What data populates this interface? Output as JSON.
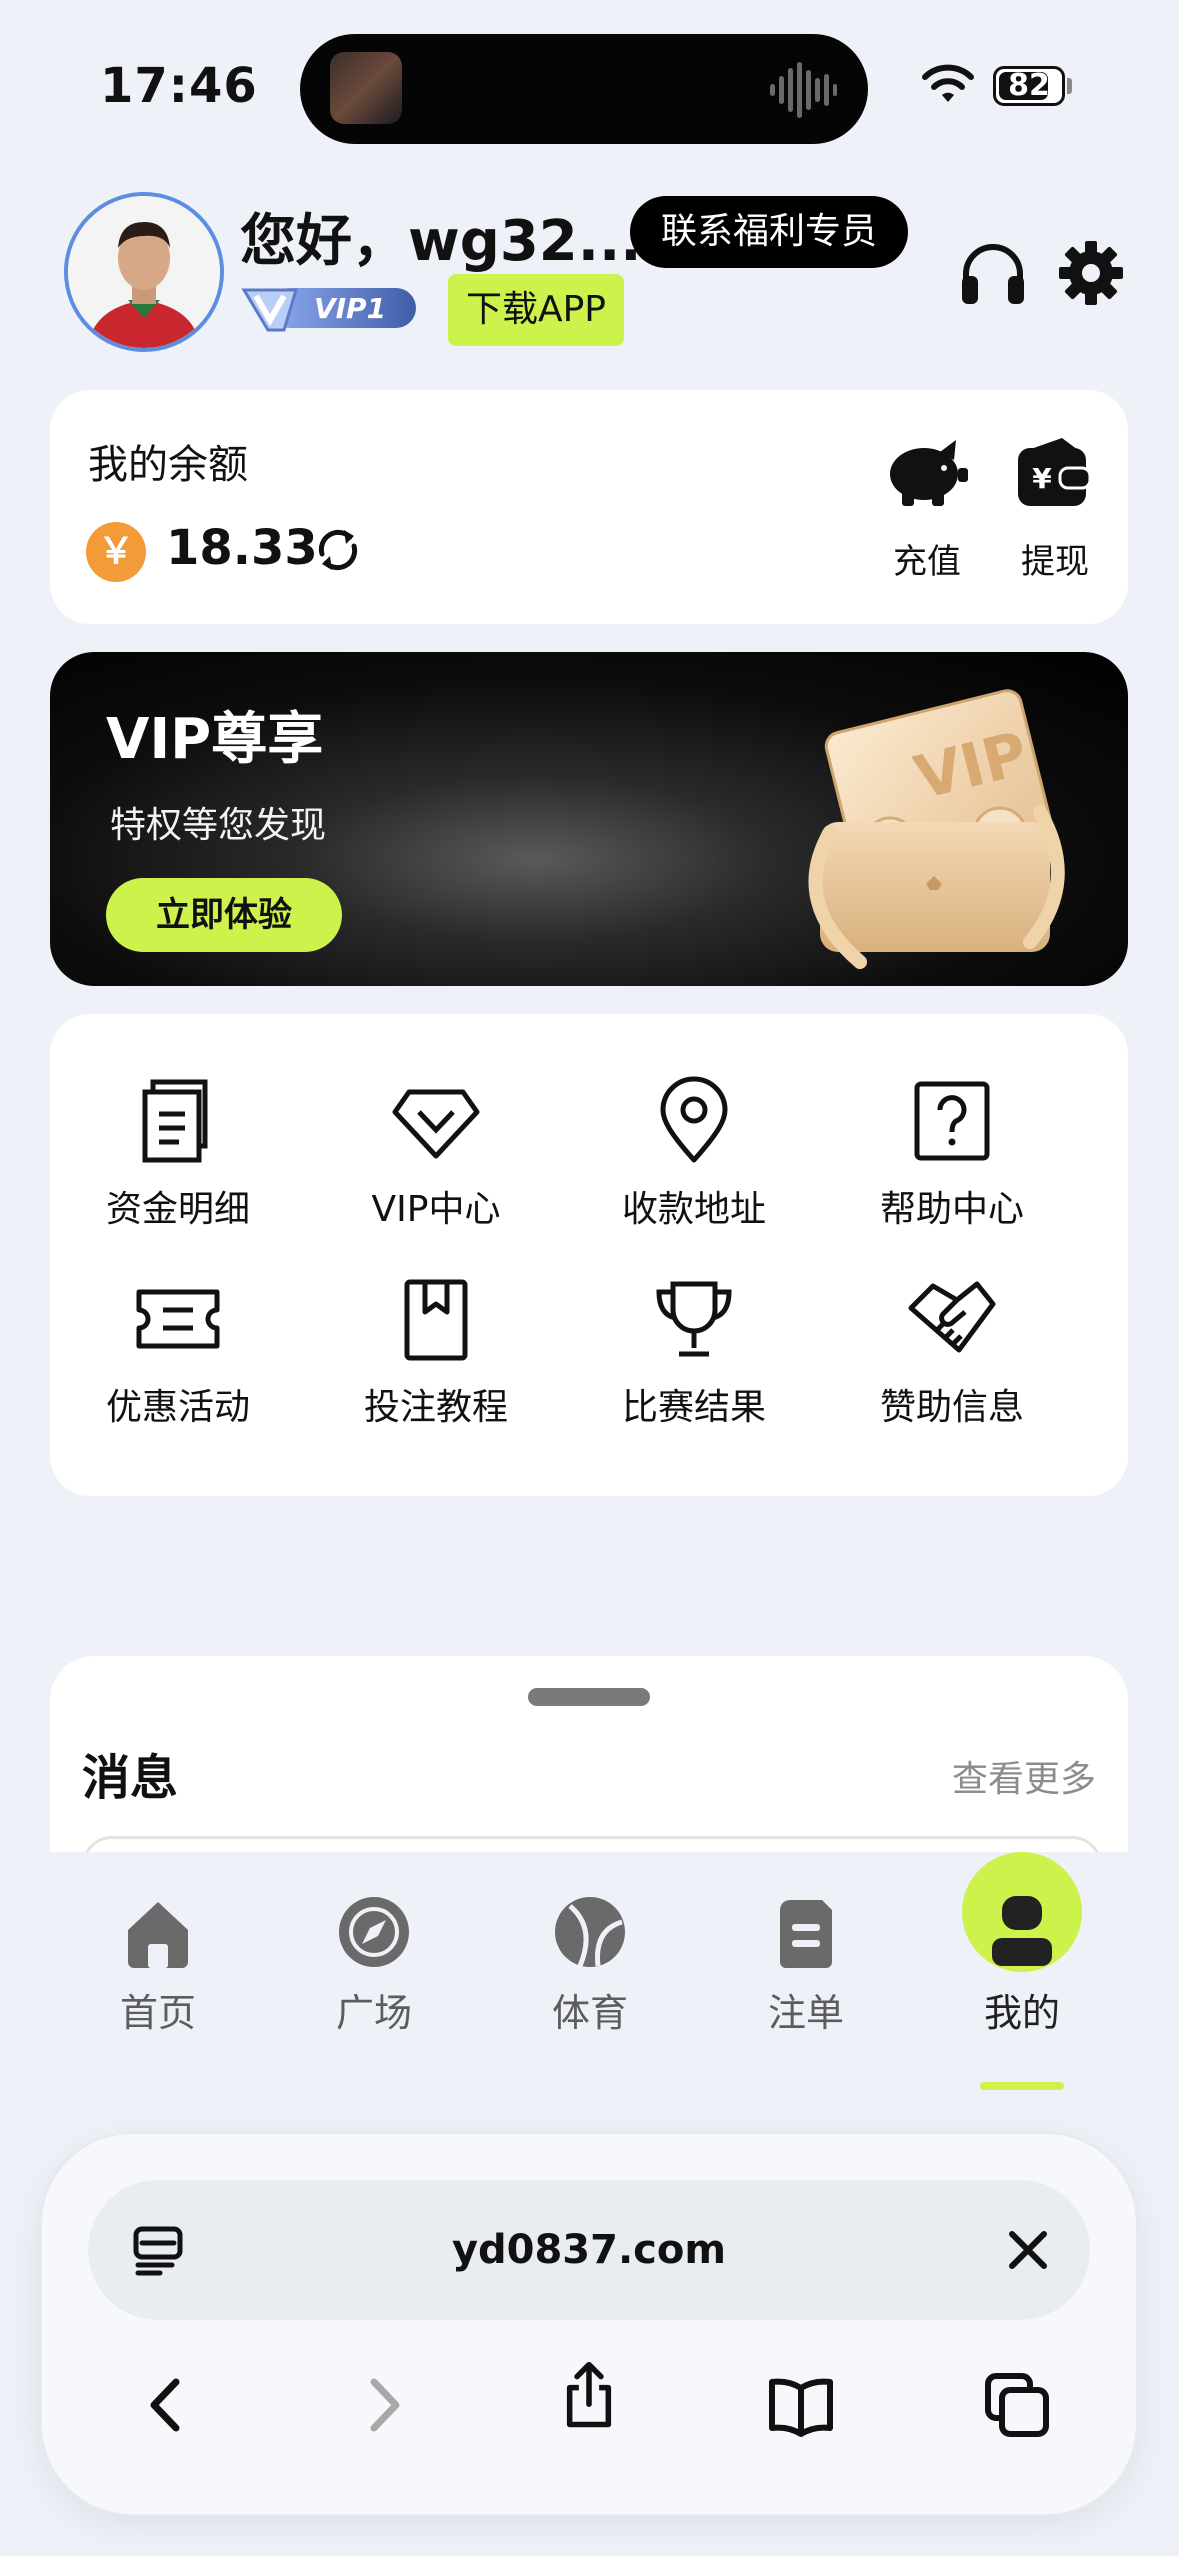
{
  "status_bar": {
    "time": "17:46",
    "battery": "82",
    "battery_level": 0.82
  },
  "header": {
    "greeting": "您好，wg32...",
    "contact_label": "联系福利专员",
    "vip_level": "VIP1",
    "download_label": "下载APP"
  },
  "balance": {
    "title": "我的余额",
    "currency_symbol": "￥",
    "amount": "18.33",
    "recharge_label": "充值",
    "withdraw_label": "提现",
    "withdraw_icon_text": "¥"
  },
  "vip_banner": {
    "title": "VIP尊享",
    "subtitle": "特权等您发现",
    "button_label": "立即体验",
    "wallet_text": "VIP"
  },
  "menu": {
    "items": [
      {
        "label": "资金明细",
        "icon": "document-stack-icon"
      },
      {
        "label": "VIP中心",
        "icon": "diamond-icon"
      },
      {
        "label": "收款地址",
        "icon": "location-pin-icon"
      },
      {
        "label": "帮助中心",
        "icon": "help-icon"
      },
      {
        "label": "优惠活动",
        "icon": "ticket-icon"
      },
      {
        "label": "投注教程",
        "icon": "bookmark-book-icon"
      },
      {
        "label": "比赛结果",
        "icon": "trophy-icon"
      },
      {
        "label": "赞助信息",
        "icon": "handshake-icon"
      }
    ]
  },
  "messages": {
    "title": "消息",
    "more_label": "查看更多"
  },
  "tabbar": {
    "tabs": [
      {
        "label": "首页",
        "icon": "home-icon"
      },
      {
        "label": "广场",
        "icon": "compass-icon"
      },
      {
        "label": "体育",
        "icon": "ball-icon"
      },
      {
        "label": "注单",
        "icon": "ticket-list-icon"
      },
      {
        "label": "我的",
        "icon": "user-icon",
        "active": true
      }
    ]
  },
  "browser": {
    "url": "yd0837.com"
  },
  "colors": {
    "accent": "#cdf24c",
    "coin": "#f29b38",
    "background": "#eef2f8"
  }
}
